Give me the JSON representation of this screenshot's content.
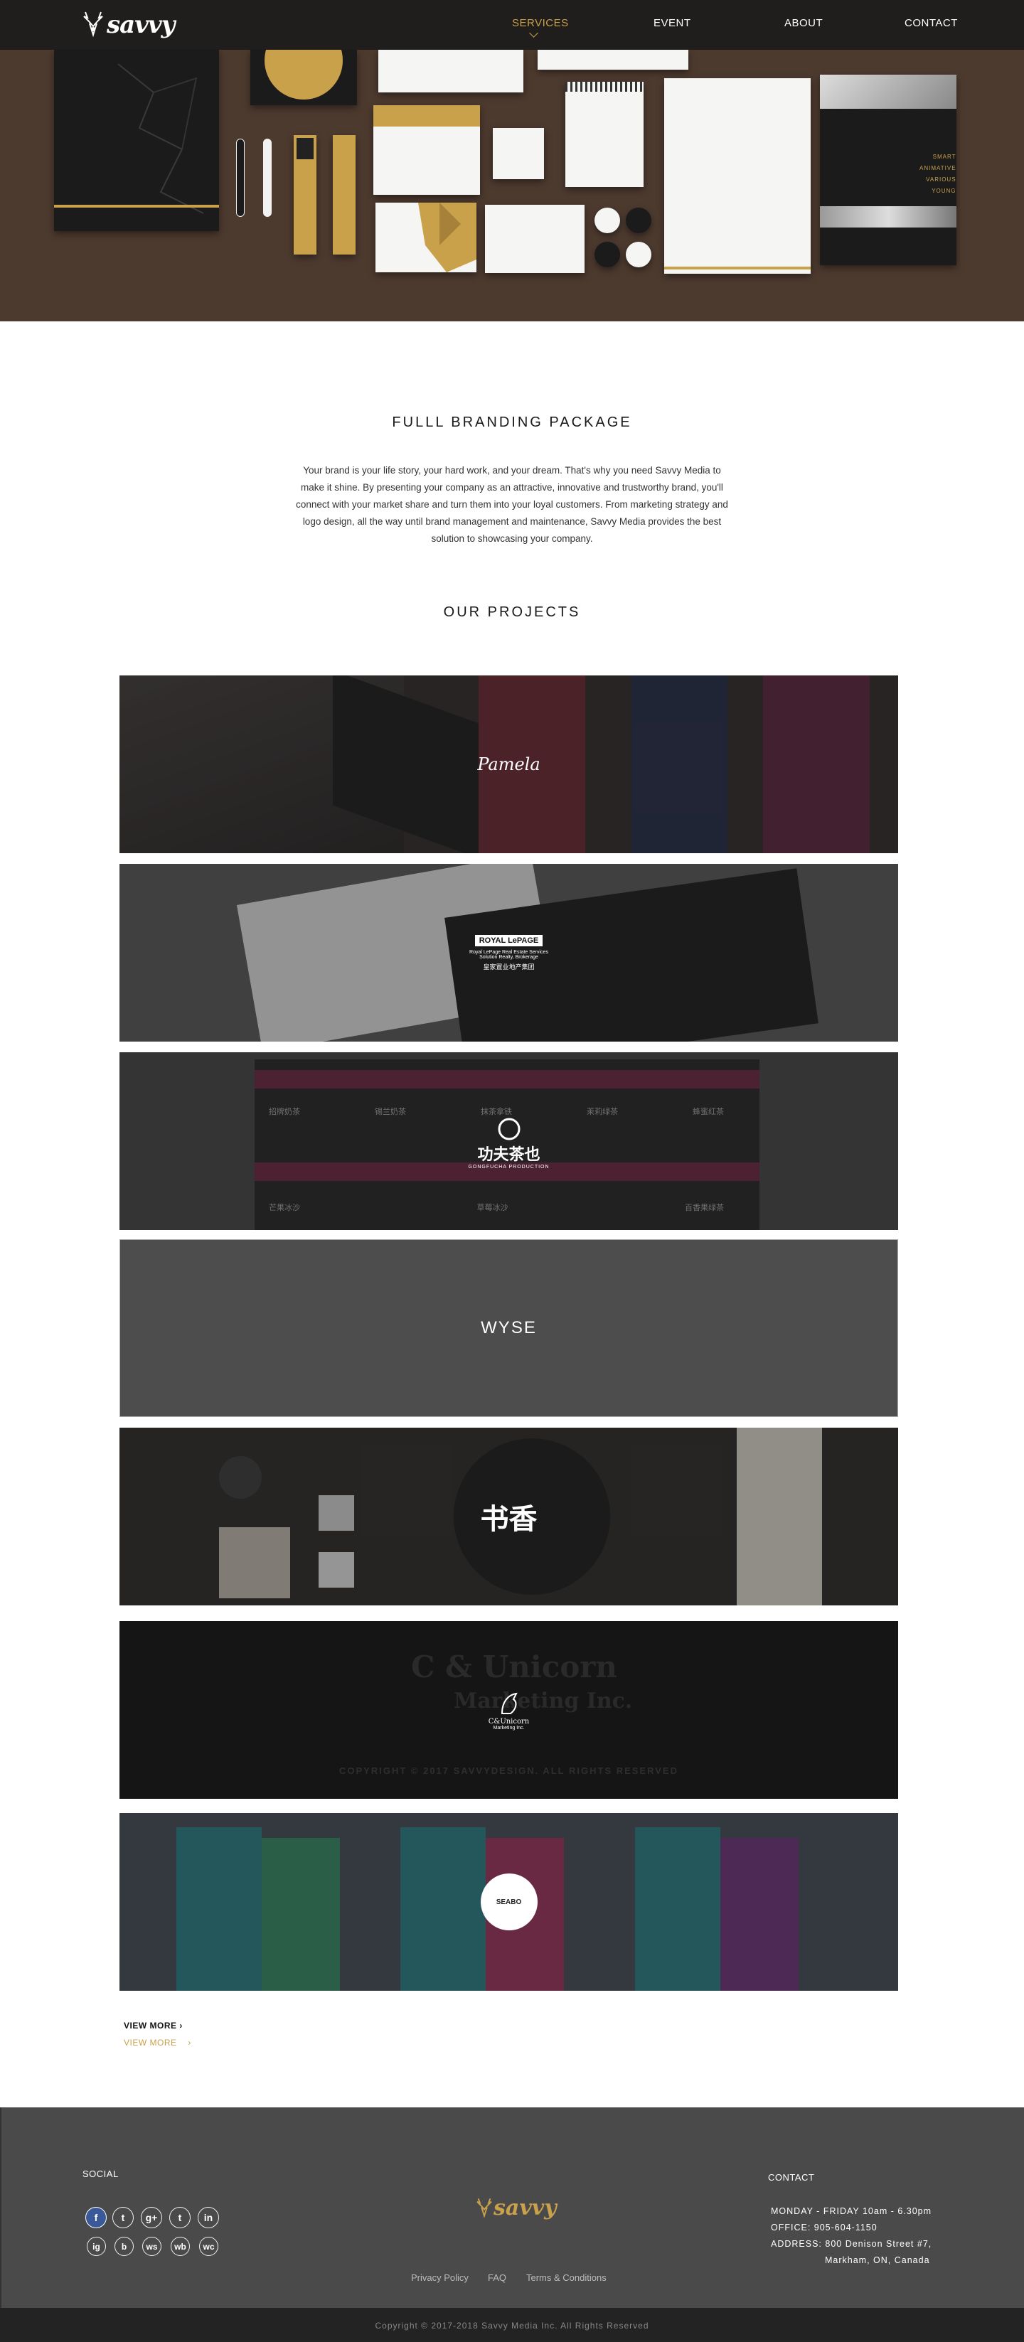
{
  "brand": {
    "name": "savvy",
    "logo_text": "SAVVY"
  },
  "nav": {
    "items": [
      {
        "label": "SERVICES",
        "active": true
      },
      {
        "label": "EVENT",
        "active": false
      },
      {
        "label": "ABOUT",
        "active": false
      },
      {
        "label": "CONTACT",
        "active": false
      }
    ]
  },
  "hero": {
    "stationery_tagline": [
      "SMART",
      "ANIMATIVE",
      "VARIOUS",
      "YOUNG"
    ]
  },
  "intro": {
    "title": "FULLL BRANDING PACKAGE",
    "text": "Your brand is your life story, your hard work, and your dream. That's why you need Savvy Media to make it shine. By presenting your company as an attractive, innovative and trustworthy brand, you'll connect with your market share and turn them into your loyal customers. From marketing strategy and logo design, all the way until brand management and maintenance, Savvy Media provides the best solution to showcasing your company."
  },
  "projects": {
    "title": "OUR PROJECTS",
    "items": [
      {
        "label": "Pamela"
      },
      {
        "label": "ROYAL LePAGE",
        "sub": "Royal LePage Real Estate Services",
        "sub2": "Solution Realty, Brokerage",
        "cn": "皇家置业地产集团"
      },
      {
        "label": "功夫茶也",
        "sub": "GONGFUCHA PRODUCTION",
        "menu": [
          "招牌奶茶",
          "锡兰奶茶",
          "抹茶拿铁",
          "茉莉绿茶",
          "蜂蜜红茶",
          "芒果冰沙",
          "草莓冰沙",
          "百香果绿茶"
        ]
      },
      {
        "label": "WYSE"
      },
      {
        "label": "书香"
      },
      {
        "label": "C&Unicorn",
        "sub": "Marketing Inc.",
        "bg_text": "C & Unicorn",
        "bg_text2": "Marketing Inc.",
        "copyright": "COPYRIGHT © 2017 SAVVYDESIGN. ALL RIGHTS RESERVED"
      },
      {
        "label": "SEABO"
      }
    ],
    "view_more": "VIEW MORE",
    "view_more_hover": "VIEW MORE"
  },
  "footer": {
    "social_title": "SOCIAL",
    "contact_title": "CONTACT",
    "social_row1": [
      "f",
      "t",
      "g+",
      "t",
      "in"
    ],
    "social_row2": [
      "ig",
      "b",
      "ws",
      "wb",
      "wc"
    ],
    "hours": "MONDAY - FRIDAY 10am - 6.30pm",
    "office": "OFFICE:  905-604-1150",
    "address1": "ADDRESS: 800 Denison Street #7,",
    "address2": "Markham, ON, Canada",
    "links": [
      "Privacy Policy",
      "FAQ",
      "Terms & Conditions"
    ],
    "copyright": "Copyright © 2017-2018  Savvy Media Inc. All Rights Reserved"
  },
  "colors": {
    "accent": "#c9a14a",
    "header": "#1f1e1d",
    "hero_bg": "#4d3a2f",
    "footer": "#4a4a4a",
    "bottombar": "#232323"
  }
}
